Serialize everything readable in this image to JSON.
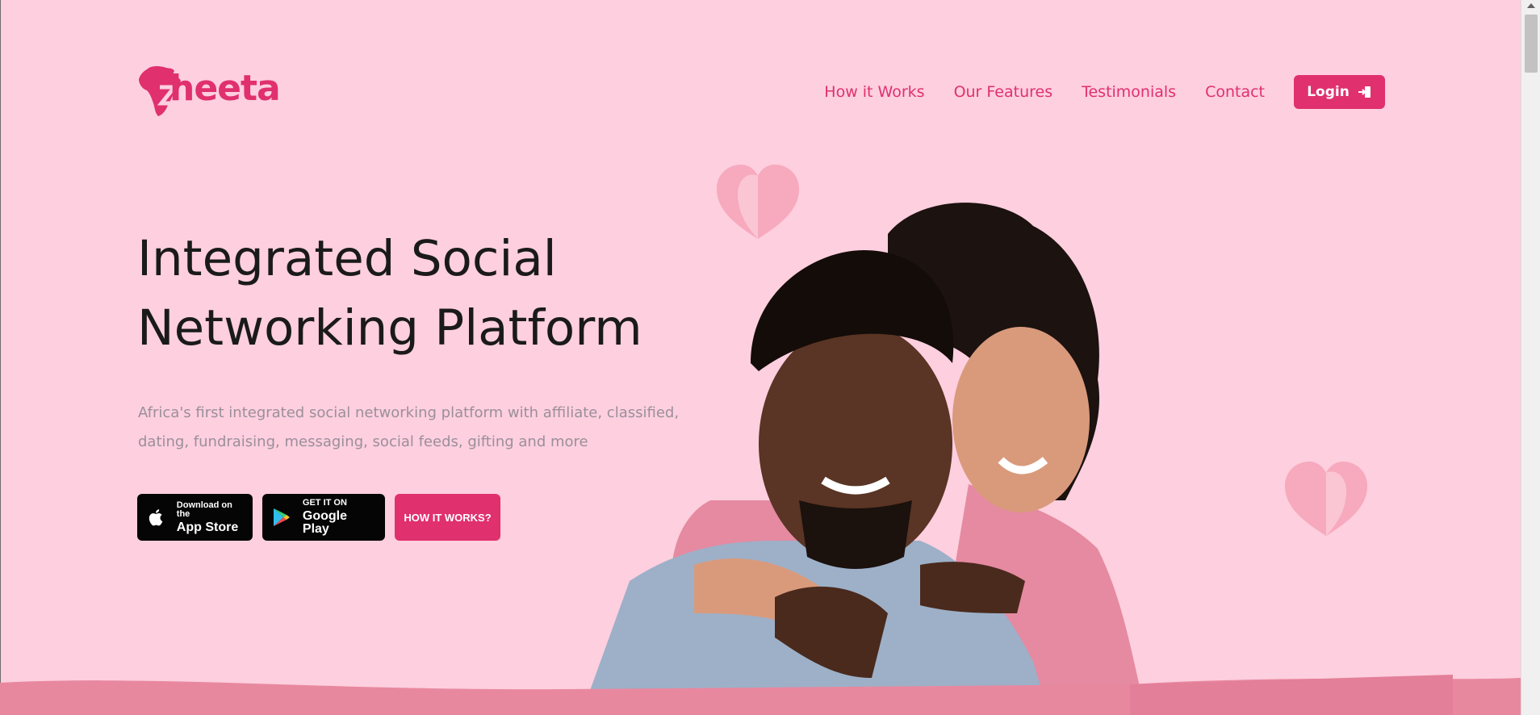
{
  "brand": {
    "logo_text": "heeta",
    "accent_color": "#e0306d",
    "background_color": "#fdcfdf"
  },
  "nav": {
    "items": [
      {
        "label": "How it Works"
      },
      {
        "label": "Our Features"
      },
      {
        "label": "Testimonials"
      },
      {
        "label": "Contact"
      }
    ],
    "login_label": "Login",
    "login_icon": "login-icon"
  },
  "hero": {
    "title_line1": "Integrated Social",
    "title_line2": "Networking Platform",
    "subtitle": "Africa's first integrated social networking platform with affiliate, classified, dating, fundraising, messaging, social feeds, gifting and more",
    "app_store": {
      "small": "Download on the",
      "big": "App Store",
      "icon": "apple-icon"
    },
    "google_play": {
      "small": "GET IT ON",
      "big": "Google Play",
      "icon": "google-play-icon"
    },
    "how_it_works_label": "HOW IT WORKS?"
  }
}
